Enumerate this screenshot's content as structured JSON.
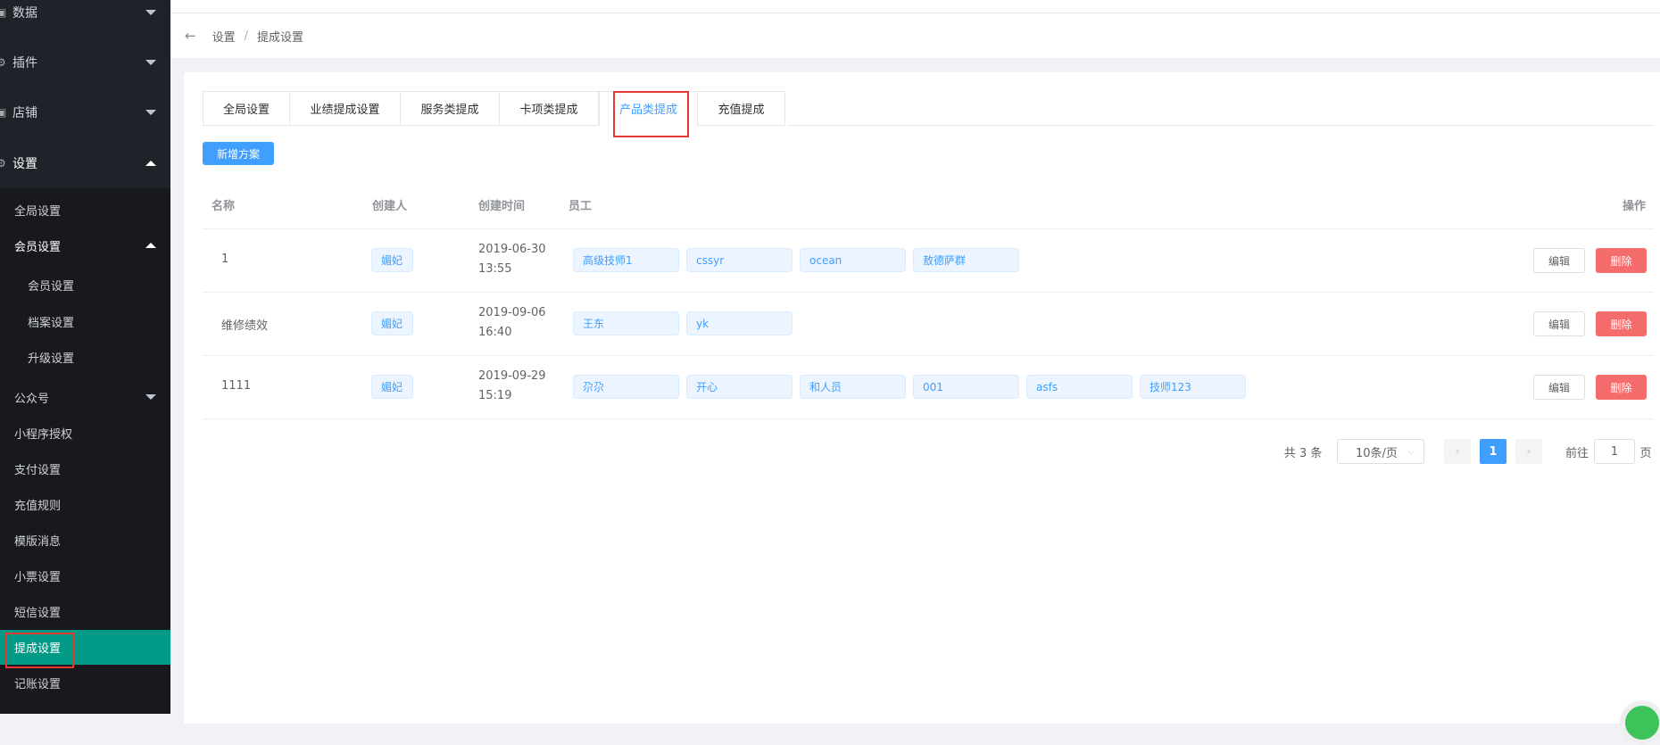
{
  "sidebar": {
    "top_items": [
      {
        "label": "数据"
      },
      {
        "label": "插件"
      },
      {
        "label": "店铺"
      },
      {
        "label": "设置"
      }
    ],
    "sub_items": [
      {
        "label": "全局设置"
      },
      {
        "label": "会员设置"
      },
      {
        "label": "会员设置"
      },
      {
        "label": "档案设置"
      },
      {
        "label": "升级设置"
      },
      {
        "label": "公众号"
      },
      {
        "label": "小程序授权"
      },
      {
        "label": "支付设置"
      },
      {
        "label": "充值规则"
      },
      {
        "label": "模版消息"
      },
      {
        "label": "小票设置"
      },
      {
        "label": "短信设置"
      },
      {
        "label": "提成设置"
      },
      {
        "label": "记账设置"
      }
    ]
  },
  "breadcrumb": {
    "back_icon": "←",
    "items": [
      "设置",
      "提成设置"
    ],
    "sep": "/"
  },
  "tabs": [
    {
      "label": "全局设置"
    },
    {
      "label": "业绩提成设置"
    },
    {
      "label": "服务类提成"
    },
    {
      "label": "卡项类提成"
    },
    {
      "label": "产品类提成"
    },
    {
      "label": "充值提成"
    }
  ],
  "active_tab": "产品类提成",
  "add_button": "新增方案",
  "table": {
    "headers": {
      "name": "名称",
      "creator": "创建人",
      "time": "创建时间",
      "staff": "员工",
      "ops": "操作"
    },
    "rows": [
      {
        "name": "1",
        "creator": "媚妃",
        "date": "2019-06-30",
        "time": "13:55",
        "staff": [
          "高级技师1",
          "cssyr",
          "ocean",
          "敖德萨群"
        ],
        "edit": "编辑",
        "delete": "删除"
      },
      {
        "name": "维修绩效",
        "creator": "媚妃",
        "date": "2019-09-06",
        "time": "16:40",
        "staff": [
          "王东",
          "yk"
        ],
        "edit": "编辑",
        "delete": "删除"
      },
      {
        "name": "1111",
        "creator": "媚妃",
        "date": "2019-09-29",
        "time": "15:19",
        "staff": [
          "尕尕",
          "开心",
          "和人员",
          "001",
          "asfs",
          "技师123"
        ],
        "edit": "编辑",
        "delete": "删除"
      }
    ]
  },
  "pagination": {
    "total": "共 3 条",
    "page_size": "10条/页",
    "current_page": "1",
    "goto_label": "前往",
    "goto_value": "1",
    "page_suffix": "页"
  },
  "colors": {
    "primary": "#409eff",
    "danger": "#f56c6c",
    "sidebar_active": "#009a87"
  }
}
